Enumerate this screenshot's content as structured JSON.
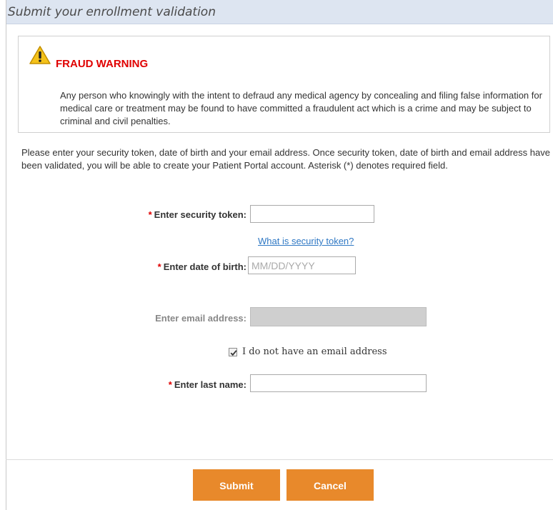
{
  "panel": {
    "title": "Submit your enrollment validation"
  },
  "warning": {
    "icon": "warning-icon",
    "title": "FRAUD WARNING",
    "text": "Any person who knowingly with the intent to defraud any medical agency by concealing and filing false information for medical care or treatment may be found to have committed a fraudulent act which is a crime and may be subject to criminal and civil penalties."
  },
  "intro": "Please enter your security token, date of birth and your email address. Once security token, date of birth and email address have been validated, you will be able to create your Patient Portal account. Asterisk (*) denotes required field.",
  "form": {
    "required_marker": "*",
    "security_token": {
      "label": "Enter security token:",
      "value": "",
      "placeholder": ""
    },
    "security_token_link": "What is security token?",
    "dob": {
      "label": "Enter date of birth:",
      "value": "",
      "placeholder": "MM/DD/YYYY"
    },
    "email": {
      "label": "Enter email address:",
      "value": "",
      "placeholder": "",
      "disabled": true
    },
    "no_email": {
      "label": "I do not have an email address",
      "checked": true
    },
    "last_name": {
      "label": "Enter last name:",
      "value": "",
      "placeholder": ""
    }
  },
  "buttons": {
    "submit": "Submit",
    "cancel": "Cancel"
  },
  "colors": {
    "accent": "#e8892b",
    "required": "#e00000",
    "link": "#2f78c4",
    "header_bg": "#dde5f1"
  }
}
